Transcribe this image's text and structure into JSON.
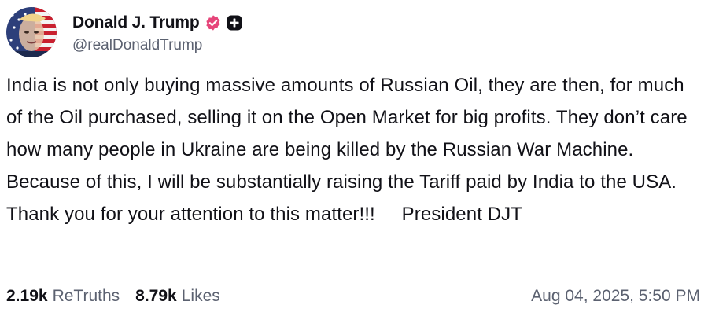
{
  "post": {
    "author": {
      "display_name": "Donald J. Trump",
      "handle": "@realDonaldTrump",
      "avatar_icon": "profile-avatar",
      "verified_icon": "verified-badge-icon",
      "verified_color": "#e6457a",
      "plus_icon": "plus-badge-icon"
    },
    "text": "India is not only buying massive amounts of Russian Oil, they are then, for much of the Oil purchased, selling it on the Open Market for big profits. They don’t care how many people in Ukraine are being killed by the Russian War Machine. Because of this, I will be substantially raising the Tariff paid by India to the USA. Thank you for your attention to this matter!!!     President DJT",
    "retruths": {
      "count": "2.19k",
      "label": "ReTruths"
    },
    "likes": {
      "count": "8.79k",
      "label": "Likes"
    },
    "timestamp": "Aug 04, 2025, 5:50 PM"
  }
}
